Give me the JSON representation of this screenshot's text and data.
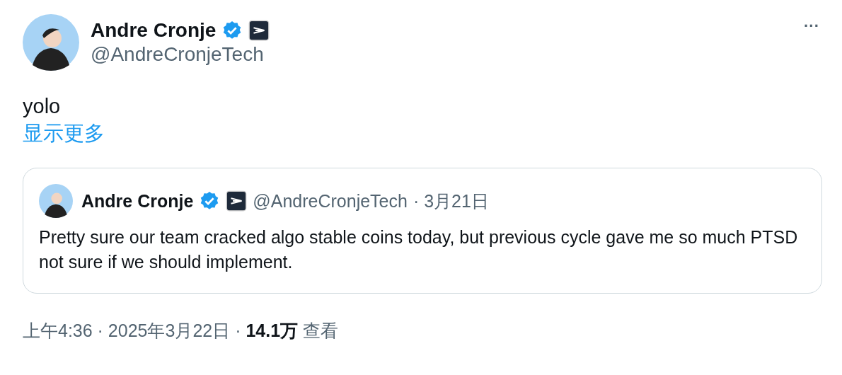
{
  "author": {
    "name": "Andre Cronje",
    "handle": "@AndreCronjeTech",
    "verified": true
  },
  "text": "yolo",
  "show_more": "显示更多",
  "quote": {
    "author": {
      "name": "Andre Cronje",
      "handle": "@AndreCronjeTech",
      "verified": true
    },
    "date": "· 3月21日",
    "text": "Pretty sure our team cracked algo stable coins today, but previous cycle gave me so much PTSD not sure if we should implement."
  },
  "more_button": "···",
  "meta": "上午4:36 · 2025年3月22日 · **14.1万** 查看"
}
